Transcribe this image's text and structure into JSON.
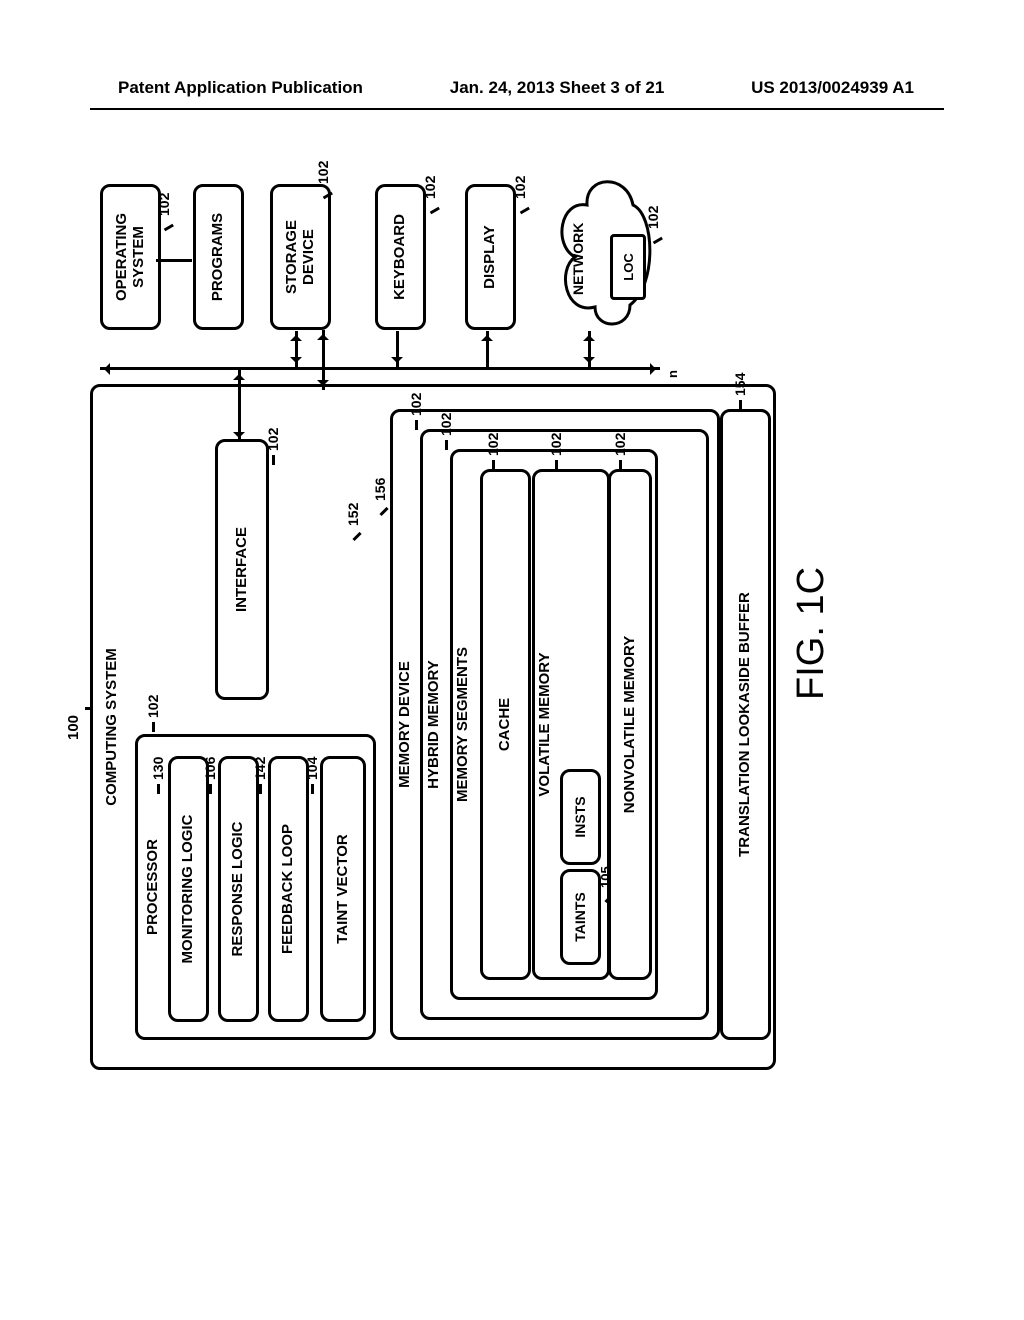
{
  "header": {
    "left": "Patent Application Publication",
    "mid": "Jan. 24, 2013  Sheet 3 of 21",
    "right": "US 2013/0024939 A1"
  },
  "fig": {
    "number": "FIG. 1C",
    "system_ref": "100",
    "computing_system": "COMPUTING SYSTEM",
    "processor": {
      "label": "PROCESSOR",
      "ref": "102",
      "monitoring": {
        "label": "MONITORING LOGIC",
        "ref": "130"
      },
      "response": {
        "label": "RESPONSE LOGIC",
        "ref": "106"
      },
      "feedback": {
        "label": "FEEDBACK LOOP",
        "ref": "142"
      }
    },
    "taint_vector": {
      "label": "TAINT VECTOR",
      "ref": "104"
    },
    "interface": {
      "label": "INTERFACE",
      "ref": "102",
      "alt_ref": "152"
    },
    "memory_device": {
      "label": "MEMORY DEVICE",
      "ref": "156"
    },
    "hybrid_memory": {
      "label": "HYBRID MEMORY",
      "ref": "102"
    },
    "memory_segments": {
      "label": "MEMORY SEGMENTS",
      "ref": "102"
    },
    "cache": {
      "label": "CACHE",
      "ref": "102"
    },
    "volatile_memory": {
      "label": "VOLATILE MEMORY",
      "ref": "102",
      "taints": {
        "label": "TAINTS",
        "ref": "105"
      },
      "insts": {
        "label": "INSTS"
      }
    },
    "nonvolatile": {
      "label": "NONVOLATILE MEMORY",
      "ref": "102"
    },
    "tlb": {
      "label": "TRANSLATION LOOKASIDE BUFFER",
      "ref": "154"
    },
    "os": {
      "label": "OPERATING SYSTEM",
      "ref": "102"
    },
    "programs": {
      "label": "PROGRAMS"
    },
    "storage": {
      "label": "STORAGE DEVICE",
      "ref": "102"
    },
    "keyboard": {
      "label": "KEYBOARD",
      "ref": "102"
    },
    "display": {
      "label": "DISPLAY",
      "ref": "102"
    },
    "network": {
      "label": "NETWORK",
      "loc": "LOC",
      "ref": "102"
    },
    "bus_n": "n"
  }
}
